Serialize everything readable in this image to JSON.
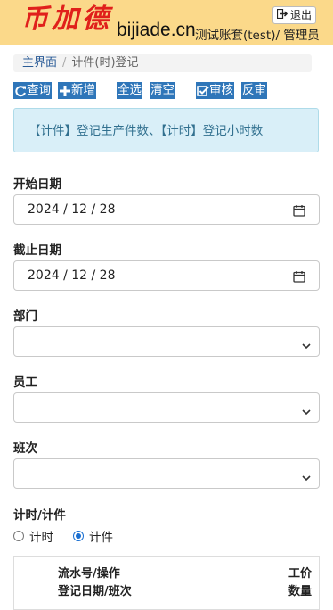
{
  "header": {
    "logo_text": "币加德",
    "domain": "bijiade.cn",
    "logout_label": "退出",
    "account_text": "测试账套(test)/ 管理员"
  },
  "breadcrumb": {
    "home": "主界面",
    "separator": "/",
    "current": "计件(时)登记"
  },
  "toolbar": {
    "query": "查询",
    "add": "新增",
    "select_all": "全选",
    "clear": "清空",
    "approve": "审核",
    "unapprove": "反审"
  },
  "alert": "【计件】登记生产件数、【计时】登记小时数",
  "form": {
    "start_date": {
      "label": "开始日期",
      "value": "2024 / 12 / 28"
    },
    "end_date": {
      "label": "截止日期",
      "value": "2024 / 12 / 28"
    },
    "department": {
      "label": "部门",
      "value": ""
    },
    "employee": {
      "label": "员工",
      "value": ""
    },
    "shift": {
      "label": "班次",
      "value": ""
    },
    "mode": {
      "label": "计时/计件",
      "options": [
        {
          "label": "计时",
          "checked": false
        },
        {
          "label": "计件",
          "checked": true
        }
      ]
    }
  },
  "table": {
    "col1_line1": "流水号/操作",
    "col1_line2": "登记日期/班次",
    "col2_line1": "工价",
    "col2_line2": "数量"
  },
  "colors": {
    "header_bg": "#fbd98a",
    "logo_red": "#e0201b",
    "button_blue": "#2f76b9",
    "alert_bg": "#d9eff8",
    "alert_text": "#31708f"
  }
}
